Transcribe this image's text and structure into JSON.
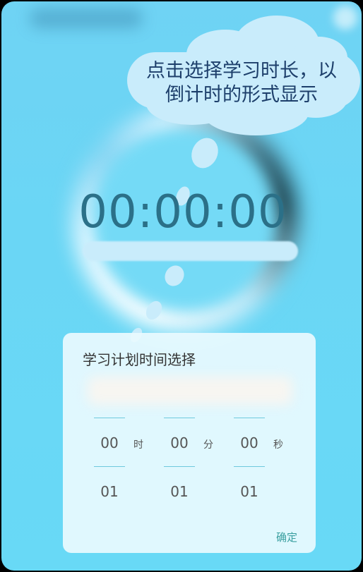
{
  "timer": {
    "display": "00:00:00"
  },
  "tooltip": {
    "line1": "点击选择学习时长，以",
    "line2": "倒计时的形式显示"
  },
  "dialog": {
    "title": "学习计划时间选择",
    "columns": [
      {
        "value": "00",
        "unit": "时",
        "next": "01"
      },
      {
        "value": "00",
        "unit": "分",
        "next": "01"
      },
      {
        "value": "00",
        "unit": "秒",
        "next": "01"
      }
    ],
    "confirm_label": "确定"
  },
  "colors": {
    "background": "#6dd6f5",
    "accent": "#3a9fa0",
    "timer_text": "#2b7088",
    "cloud": "#c9ecfb"
  }
}
